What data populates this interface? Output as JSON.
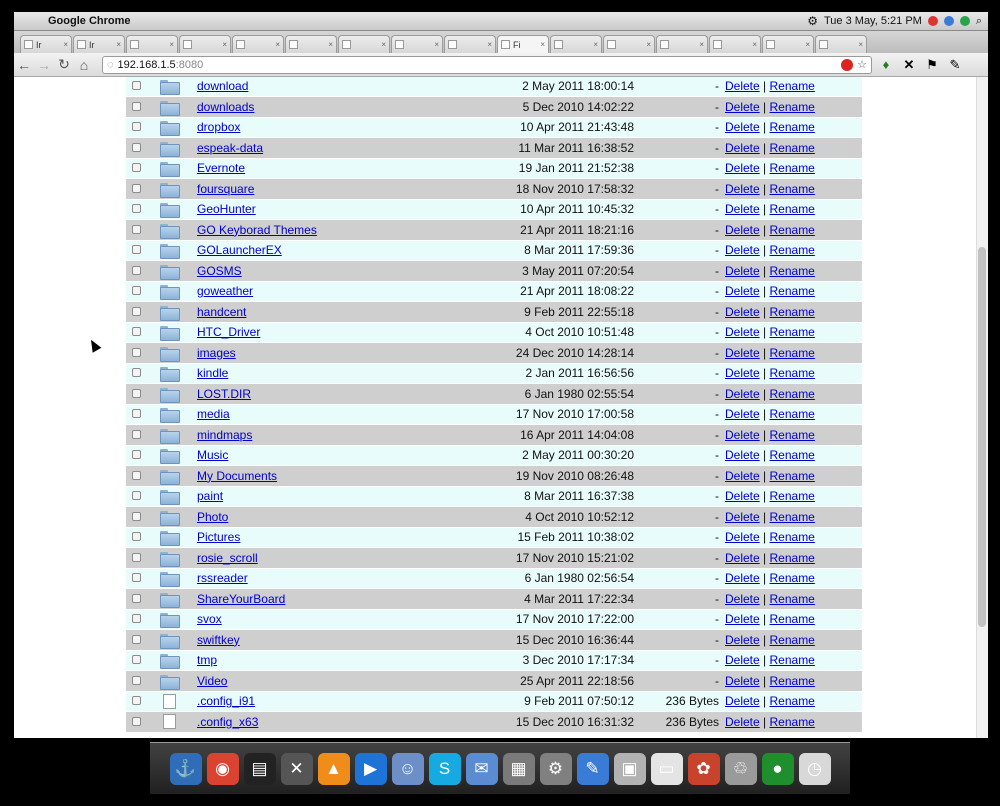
{
  "menubar": {
    "app_name": "Google Chrome",
    "clock": "Tue  3 May,   5:21 PM"
  },
  "tabs": [
    {
      "label": "Ir"
    },
    {
      "label": "Ir"
    },
    {
      "label": ""
    },
    {
      "label": ""
    },
    {
      "label": ""
    },
    {
      "label": ""
    },
    {
      "label": ""
    },
    {
      "label": ""
    },
    {
      "label": ""
    },
    {
      "label": "Fi"
    },
    {
      "label": ""
    },
    {
      "label": ""
    },
    {
      "label": ""
    },
    {
      "label": ""
    },
    {
      "label": ""
    },
    {
      "label": ""
    }
  ],
  "toolbar": {
    "url_host": "192.168.1.5",
    "url_port": ":8080"
  },
  "files": {
    "action_delete": "Delete",
    "action_separator": "|",
    "action_rename": "Rename",
    "rows": [
      {
        "name": "download",
        "date": "2 May 2011 18:00:14",
        "size": "-",
        "kind": "folder"
      },
      {
        "name": "downloads",
        "date": "5 Dec 2010 14:02:22",
        "size": "-",
        "kind": "folder"
      },
      {
        "name": "dropbox",
        "date": "10 Apr 2011 21:43:48",
        "size": "-",
        "kind": "folder"
      },
      {
        "name": "espeak-data",
        "date": "11 Mar 2011 16:38:52",
        "size": "-",
        "kind": "folder"
      },
      {
        "name": "Evernote",
        "date": "19 Jan 2011 21:52:38",
        "size": "-",
        "kind": "folder"
      },
      {
        "name": "foursquare",
        "date": "18 Nov 2010 17:58:32",
        "size": "-",
        "kind": "folder"
      },
      {
        "name": "GeoHunter",
        "date": "10 Apr 2011 10:45:32",
        "size": "-",
        "kind": "folder"
      },
      {
        "name": "GO Keyborad Themes",
        "date": "21 Apr 2011 18:21:16",
        "size": "-",
        "kind": "folder"
      },
      {
        "name": "GOLauncherEX",
        "date": "8 Mar 2011 17:59:36",
        "size": "-",
        "kind": "folder"
      },
      {
        "name": "GOSMS",
        "date": "3 May 2011 07:20:54",
        "size": "-",
        "kind": "folder"
      },
      {
        "name": "goweather",
        "date": "21 Apr 2011 18:08:22",
        "size": "-",
        "kind": "folder"
      },
      {
        "name": "handcent",
        "date": "9 Feb 2011 22:55:18",
        "size": "-",
        "kind": "folder"
      },
      {
        "name": "HTC_Driver",
        "date": "4 Oct 2010 10:51:48",
        "size": "-",
        "kind": "folder"
      },
      {
        "name": "images",
        "date": "24 Dec 2010 14:28:14",
        "size": "-",
        "kind": "folder"
      },
      {
        "name": "kindle",
        "date": "2 Jan 2011 16:56:56",
        "size": "-",
        "kind": "folder"
      },
      {
        "name": "LOST.DIR",
        "date": "6 Jan 1980 02:55:54",
        "size": "-",
        "kind": "folder"
      },
      {
        "name": "media",
        "date": "17 Nov 2010 17:00:58",
        "size": "-",
        "kind": "folder"
      },
      {
        "name": "mindmaps",
        "date": "16 Apr 2011 14:04:08",
        "size": "-",
        "kind": "folder"
      },
      {
        "name": "Music",
        "date": "2 May 2011 00:30:20",
        "size": "-",
        "kind": "folder"
      },
      {
        "name": "My Documents",
        "date": "19 Nov 2010 08:26:48",
        "size": "-",
        "kind": "folder"
      },
      {
        "name": "paint",
        "date": "8 Mar 2011 16:37:38",
        "size": "-",
        "kind": "folder"
      },
      {
        "name": "Photo",
        "date": "4 Oct 2010 10:52:12",
        "size": "-",
        "kind": "folder"
      },
      {
        "name": "Pictures",
        "date": "15 Feb 2011 10:38:02",
        "size": "-",
        "kind": "folder"
      },
      {
        "name": "rosie_scroll",
        "date": "17 Nov 2010 15:21:02",
        "size": "-",
        "kind": "folder"
      },
      {
        "name": "rssreader",
        "date": "6 Jan 1980 02:56:54",
        "size": "-",
        "kind": "folder"
      },
      {
        "name": "ShareYourBoard",
        "date": "4 Mar 2011 17:22:34",
        "size": "-",
        "kind": "folder"
      },
      {
        "name": "svox",
        "date": "17 Nov 2010 17:22:00",
        "size": "-",
        "kind": "folder"
      },
      {
        "name": "swiftkey",
        "date": "15 Dec 2010 16:36:44",
        "size": "-",
        "kind": "folder"
      },
      {
        "name": "tmp",
        "date": "3 Dec 2010 17:17:34",
        "size": "-",
        "kind": "folder"
      },
      {
        "name": "Video",
        "date": "25 Apr 2011 22:18:56",
        "size": "-",
        "kind": "folder"
      },
      {
        "name": ".config_i91",
        "date": "9 Feb 2011 07:50:12",
        "size": "236 Bytes",
        "kind": "file"
      },
      {
        "name": ".config_x63",
        "date": "15 Dec 2010 16:31:32",
        "size": "236 Bytes",
        "kind": "file"
      }
    ]
  },
  "dock": {
    "icons": [
      "anchor-icon",
      "chrome-icon",
      "terminal-icon",
      "x11-icon",
      "vlc-icon",
      "quicktime-icon",
      "finder-icon",
      "skype-icon",
      "mail-icon",
      "calculator-icon",
      "system-prefs-icon",
      "textedit-icon",
      "preview-icon",
      "document-icon",
      "flower-icon",
      "trash-icon",
      "green-app-icon",
      "clock-icon"
    ],
    "glyphs": [
      "⚓",
      "◉",
      "▤",
      "✕",
      "▲",
      "▶",
      "☺",
      "S",
      "✉",
      "▦",
      "⚙",
      "✎",
      "▣",
      "▭",
      "✿",
      "♲",
      "●",
      "◷"
    ],
    "colors": [
      "#2f6db8",
      "#d9432f",
      "#222222",
      "#555555",
      "#f08c1a",
      "#1e74d6",
      "#6c8fc9",
      "#17a9e1",
      "#5b8bd0",
      "#7a7a7a",
      "#808080",
      "#3a7bd5",
      "#b2b2b2",
      "#e4e4e4",
      "#c9422c",
      "#9a9a9a",
      "#1f8f2e",
      "#d8d8d8"
    ]
  }
}
